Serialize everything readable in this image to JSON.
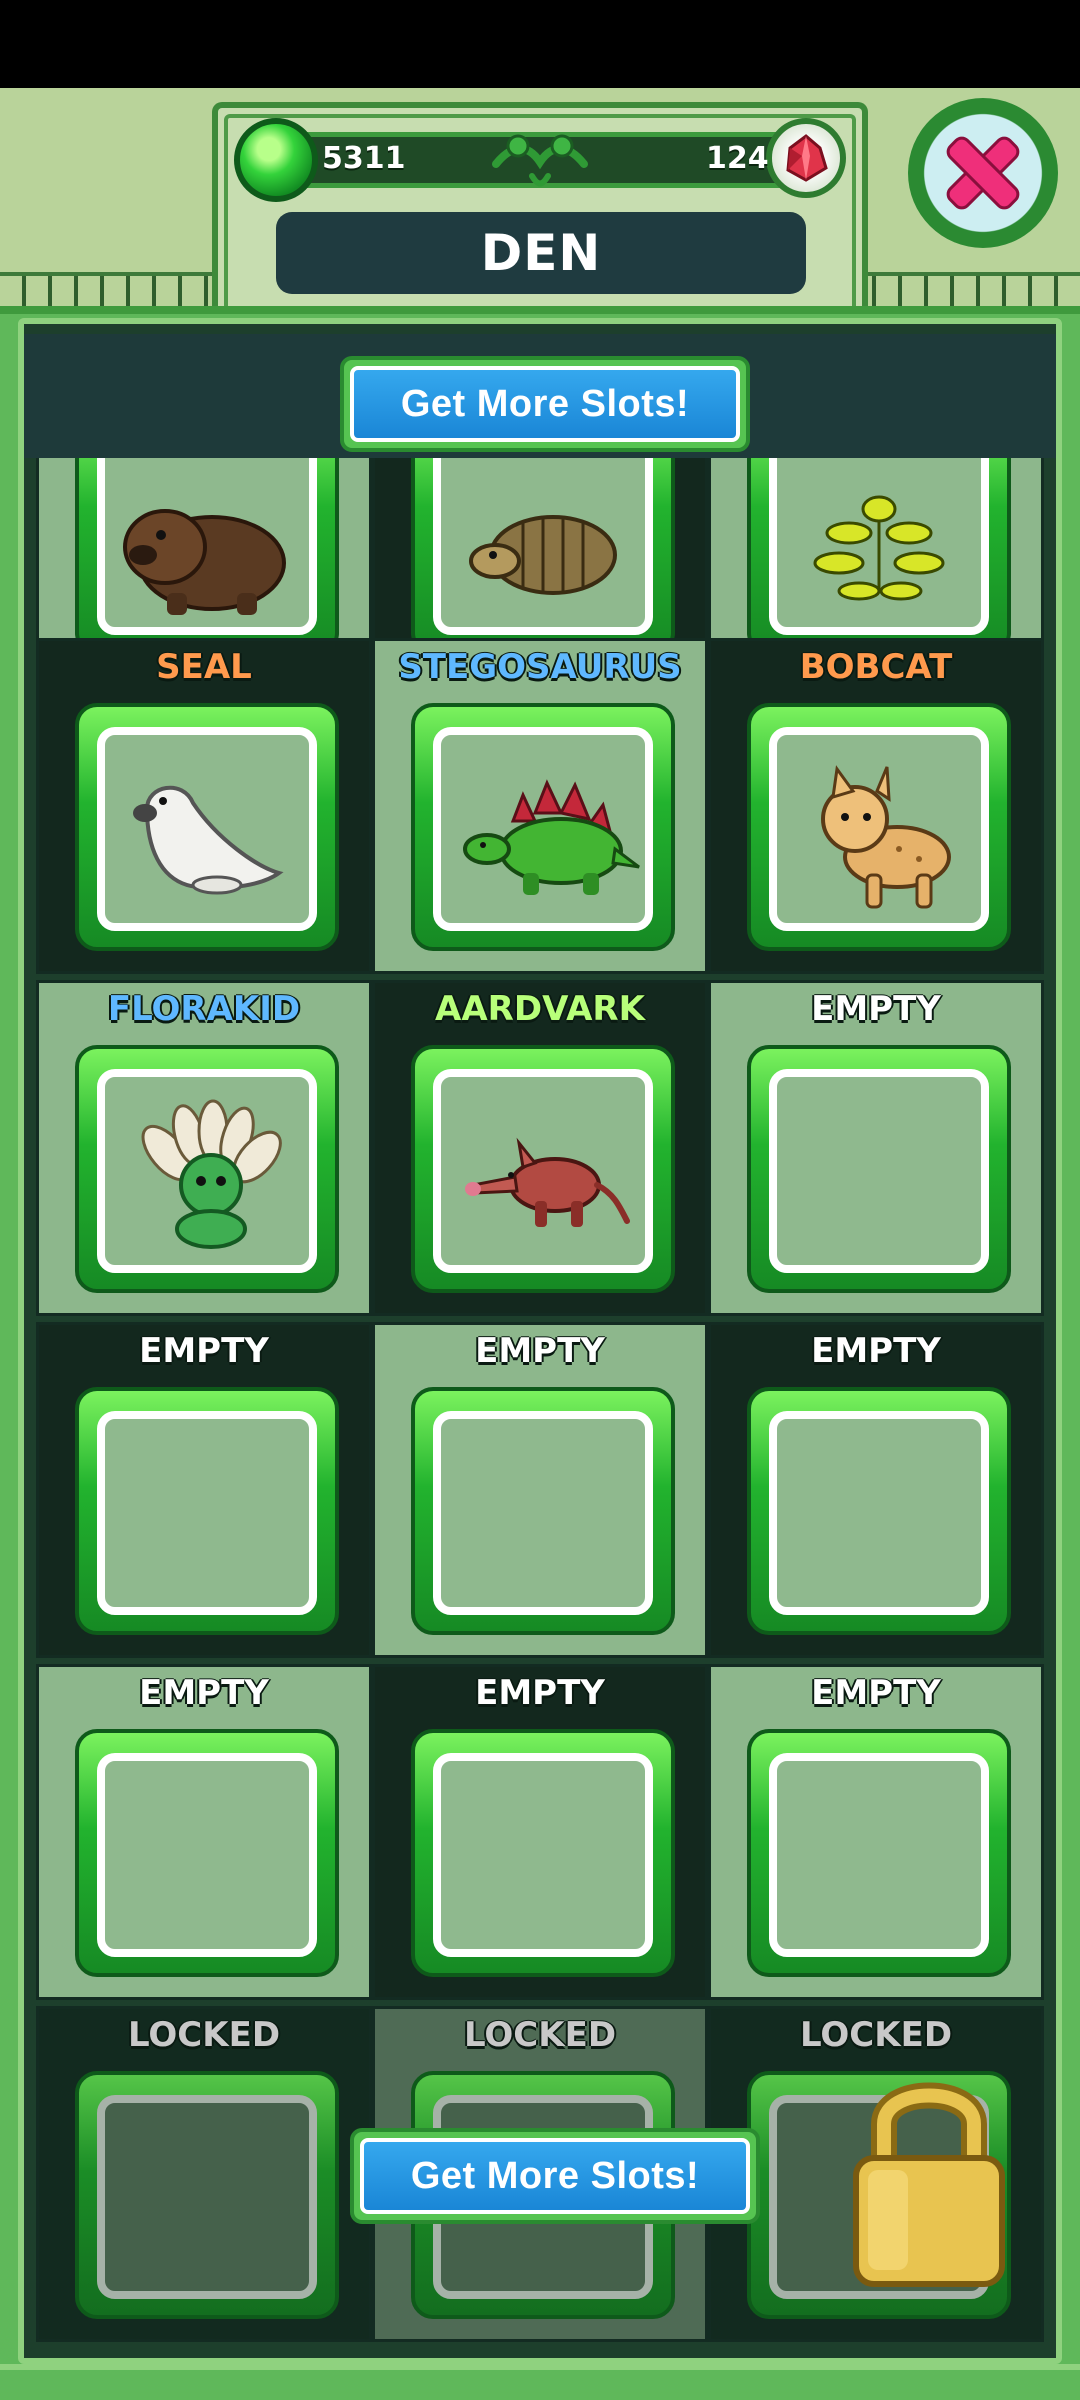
{
  "header": {
    "title": "DEN",
    "currency_green": "5311",
    "currency_red": "124",
    "more_slots_label": "Get More Slots!"
  },
  "icons": {
    "close": "close-x-icon",
    "green_gem": "green-gem-icon",
    "red_gem": "red-crystal-icon",
    "padlock": "padlock-icon"
  },
  "colors": {
    "orange_label": "#ff9a4d",
    "blue_label": "#5fb8ff",
    "green_label": "#b8ff7a",
    "white_label": "#ffffff",
    "locked_label": "#c8c8c8"
  },
  "slots": [
    {
      "label": "",
      "animal": "wombat"
    },
    {
      "label": "",
      "animal": "armadillo"
    },
    {
      "label": "",
      "animal": "plant-creature"
    },
    {
      "label": "SEAL",
      "animal": "seal"
    },
    {
      "label": "STEGOSAURUS",
      "animal": "stegosaurus"
    },
    {
      "label": "BOBCAT",
      "animal": "bobcat"
    },
    {
      "label": "FLORAKID",
      "animal": "florakid"
    },
    {
      "label": "AARDVARK",
      "animal": "aardvark"
    },
    {
      "label": "EMPTY",
      "animal": ""
    },
    {
      "label": "EMPTY",
      "animal": ""
    },
    {
      "label": "EMPTY",
      "animal": ""
    },
    {
      "label": "EMPTY",
      "animal": ""
    },
    {
      "label": "EMPTY",
      "animal": ""
    },
    {
      "label": "EMPTY",
      "animal": ""
    },
    {
      "label": "EMPTY",
      "animal": ""
    },
    {
      "label": "LOCKED",
      "animal": ""
    },
    {
      "label": "LOCKED",
      "animal": ""
    },
    {
      "label": "LOCKED",
      "animal": ""
    }
  ]
}
